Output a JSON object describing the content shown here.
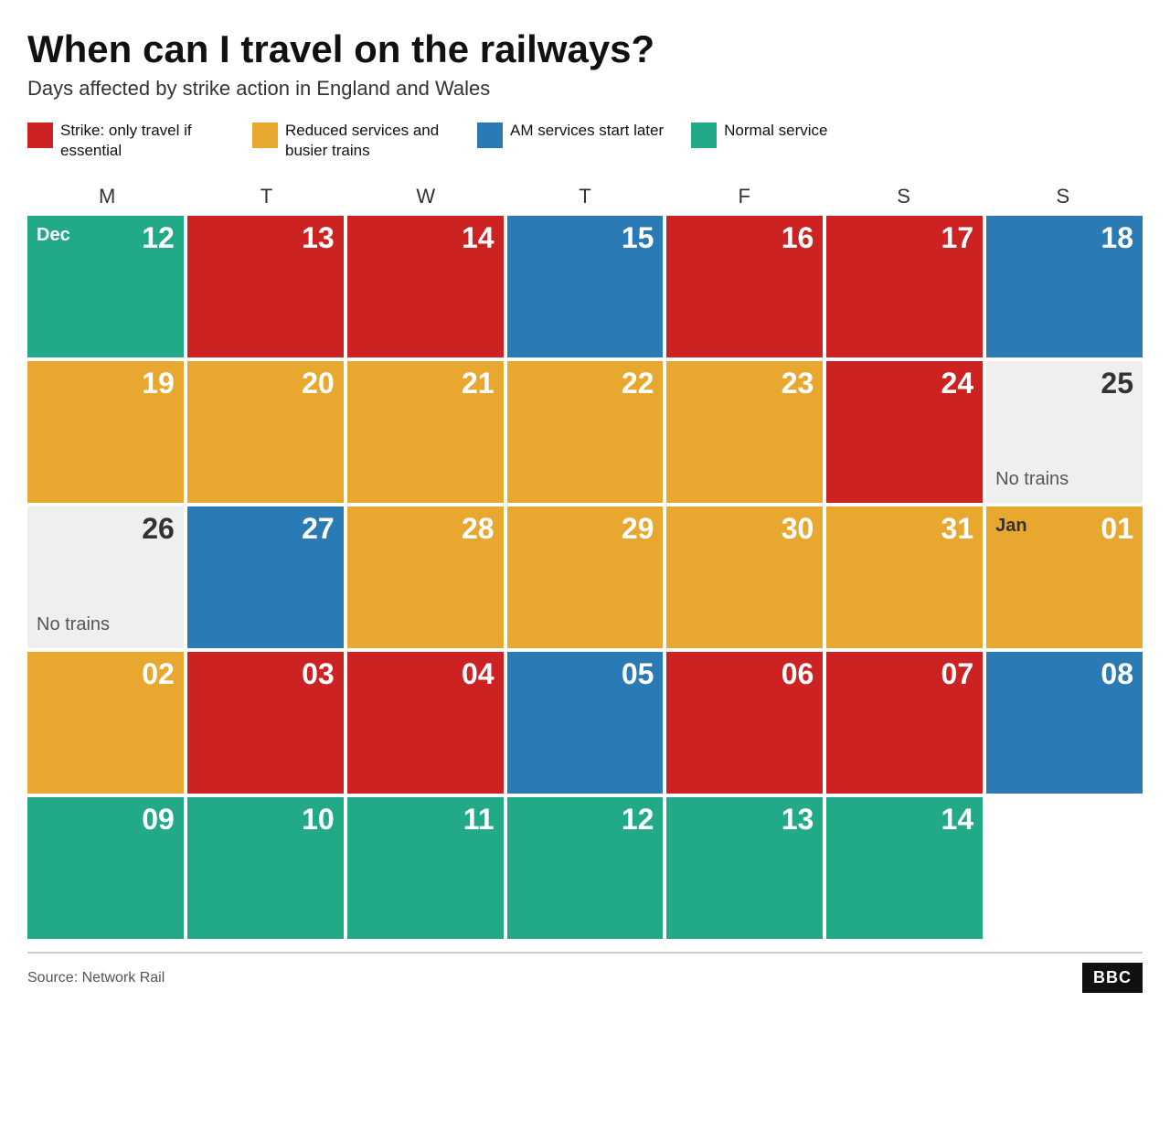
{
  "title": "When can I travel on the railways?",
  "subtitle": "Days affected by strike action in England and Wales",
  "legend": [
    {
      "id": "strike",
      "color": "#cc2222",
      "text": "Strike: only travel if essential"
    },
    {
      "id": "reduced",
      "color": "#e8a830",
      "text": "Reduced services and busier trains"
    },
    {
      "id": "am",
      "color": "#2a7ab5",
      "text": "AM services start later"
    },
    {
      "id": "normal",
      "color": "#22aa88",
      "text": "Normal service"
    }
  ],
  "day_headers": [
    "M",
    "T",
    "W",
    "T",
    "F",
    "S",
    "S"
  ],
  "rows": [
    [
      {
        "num": "12",
        "month": "Dec",
        "type": "normal"
      },
      {
        "num": "13",
        "type": "strike"
      },
      {
        "num": "14",
        "type": "strike"
      },
      {
        "num": "15",
        "type": "am"
      },
      {
        "num": "16",
        "type": "strike"
      },
      {
        "num": "17",
        "type": "strike"
      },
      {
        "num": "18",
        "type": "am"
      }
    ],
    [
      {
        "num": "19",
        "type": "reduced"
      },
      {
        "num": "20",
        "type": "reduced"
      },
      {
        "num": "21",
        "type": "reduced"
      },
      {
        "num": "22",
        "type": "reduced"
      },
      {
        "num": "23",
        "type": "reduced"
      },
      {
        "num": "24",
        "type": "strike"
      },
      {
        "num": "25",
        "type": "no-trains",
        "note": "No trains"
      }
    ],
    [
      {
        "num": "26",
        "type": "no-trains",
        "note": "No trains"
      },
      {
        "num": "27",
        "type": "am"
      },
      {
        "num": "28",
        "type": "reduced"
      },
      {
        "num": "29",
        "type": "reduced"
      },
      {
        "num": "30",
        "type": "reduced"
      },
      {
        "num": "31",
        "type": "reduced"
      },
      {
        "num": "01",
        "month": "Jan",
        "type": "reduced"
      }
    ],
    [
      {
        "num": "02",
        "type": "reduced"
      },
      {
        "num": "03",
        "type": "strike"
      },
      {
        "num": "04",
        "type": "strike"
      },
      {
        "num": "05",
        "type": "am"
      },
      {
        "num": "06",
        "type": "strike"
      },
      {
        "num": "07",
        "type": "strike"
      },
      {
        "num": "08",
        "type": "am"
      }
    ],
    [
      {
        "num": "09",
        "type": "normal"
      },
      {
        "num": "10",
        "type": "normal"
      },
      {
        "num": "11",
        "type": "normal"
      },
      {
        "num": "12",
        "type": "normal"
      },
      {
        "num": "13",
        "type": "normal"
      },
      {
        "num": "14",
        "type": "normal"
      },
      {
        "num": "",
        "type": "empty"
      }
    ]
  ],
  "footer": {
    "source": "Source: Network Rail",
    "logo": "BBC"
  }
}
